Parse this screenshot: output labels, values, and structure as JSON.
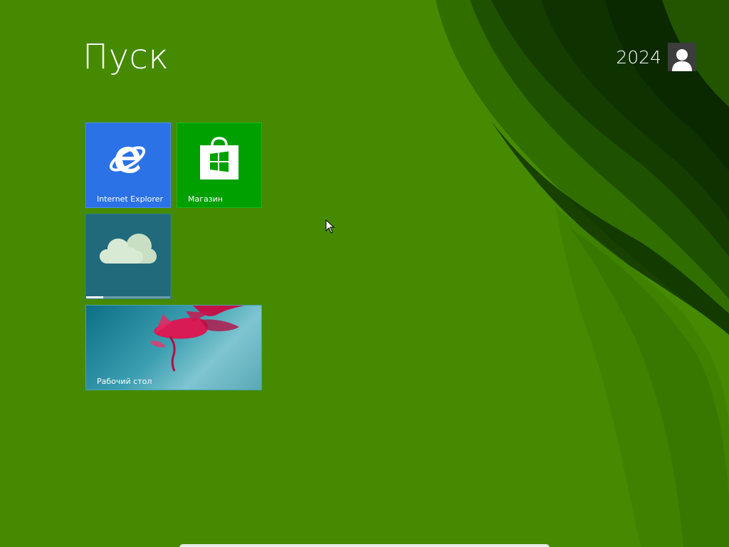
{
  "start": {
    "title": "Пуск"
  },
  "user": {
    "name": "2024",
    "avatar_icon": "user-silhouette-icon"
  },
  "tiles": {
    "ie": {
      "label": "Internet Explorer",
      "icon": "internet-explorer-icon",
      "color": "#2b72e6"
    },
    "store": {
      "label": "Магазин",
      "icon": "store-bag-icon",
      "color": "#00a000"
    },
    "onedrive": {
      "label": "",
      "icon": "cloud-icon",
      "color": "#206a7c",
      "progress": 0.2
    },
    "desktop": {
      "label": "Рабочий стол",
      "icon": "desktop-wallpaper-flower"
    }
  },
  "colors": {
    "background": "#458a00",
    "accent_dark": "#1e4a00"
  }
}
